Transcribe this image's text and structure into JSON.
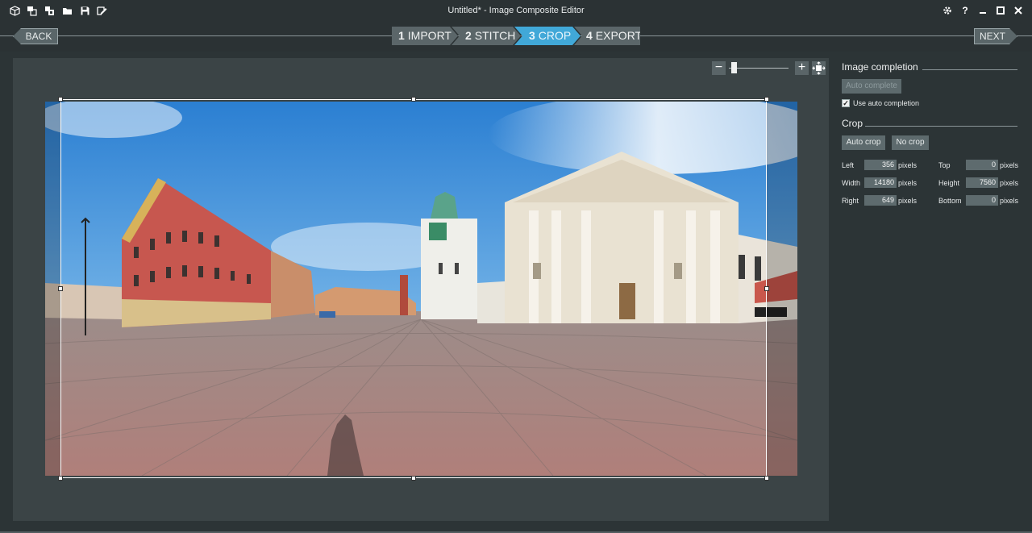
{
  "window": {
    "title": "Untitled* - Image Composite Editor",
    "quick_access_icons": [
      "new-project-icon",
      "new-panorama-icon",
      "new-video-panorama-icon",
      "open-folder-icon",
      "save-icon",
      "export-edit-icon"
    ],
    "controls": [
      "settings-icon",
      "help-icon",
      "minimize-icon",
      "maximize-icon",
      "close-icon"
    ],
    "help_glyph": "?"
  },
  "nav": {
    "back_label": "BACK",
    "next_label": "NEXT",
    "steps": [
      {
        "number": "1",
        "label": "IMPORT",
        "state": "inactive"
      },
      {
        "number": "2",
        "label": "STITCH",
        "state": "inactive"
      },
      {
        "number": "3",
        "label": "CROP",
        "state": "active"
      },
      {
        "number": "4",
        "label": "EXPORT",
        "state": "inactive"
      }
    ]
  },
  "zoom": {
    "minus_glyph": "−",
    "plus_glyph": "+",
    "level_fraction": 0.05
  },
  "panel": {
    "completion": {
      "title": "Image completion",
      "auto_complete_label": "Auto complete",
      "use_auto_label": "Use auto completion",
      "use_auto_checked": true,
      "check_glyph": "✓"
    },
    "crop": {
      "title": "Crop",
      "auto_crop_label": "Auto crop",
      "no_crop_label": "No crop",
      "unit": "pixels",
      "fields": {
        "left": {
          "label": "Left",
          "value": "356"
        },
        "top": {
          "label": "Top",
          "value": "0"
        },
        "width": {
          "label": "Width",
          "value": "14180"
        },
        "height": {
          "label": "Height",
          "value": "7560"
        },
        "right": {
          "label": "Right",
          "value": "649"
        },
        "bottom": {
          "label": "Bottom",
          "value": "0"
        }
      }
    }
  },
  "colors": {
    "accent": "#41a8d8",
    "background": "#2c3436",
    "canvas": "#3b4446"
  }
}
